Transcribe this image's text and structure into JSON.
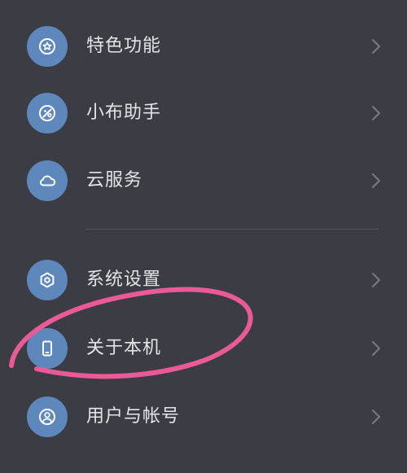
{
  "colors": {
    "background": "#3c3d44",
    "icon_bg": "#5e87bb",
    "label": "#e4e4e6",
    "chevron": "#7a7b82",
    "annotation": "#ea5a97"
  },
  "menu": {
    "items": [
      {
        "label": "特色功能",
        "icon": "star-badge-icon"
      },
      {
        "label": "小布助手",
        "icon": "assistant-icon"
      },
      {
        "label": "云服务",
        "icon": "cloud-icon"
      },
      {
        "label": "系统设置",
        "icon": "gear-hexagon-icon"
      },
      {
        "label": "关于本机",
        "icon": "phone-icon"
      },
      {
        "label": "用户与帐号",
        "icon": "user-icon"
      }
    ]
  }
}
